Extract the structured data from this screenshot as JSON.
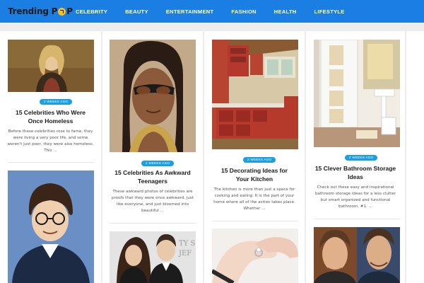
{
  "site": {
    "logo_text": "Trending P",
    "logo_suffix": "P"
  },
  "nav": [
    {
      "label": "CELEBRITY"
    },
    {
      "label": "BEAUTY"
    },
    {
      "label": "ENTERTAINMENT"
    },
    {
      "label": "FASHION"
    },
    {
      "label": "HEALTH"
    },
    {
      "label": "LIFESTYLE"
    }
  ],
  "articles": [
    {
      "badge": "2 WEEKS AGO",
      "title_line1": "15 Celebrities Who Were",
      "title_line2": "Once Homeless",
      "excerpt_line1": "Before these celebrities rose to fame, they",
      "excerpt_line2": "were living a very poor life, and some",
      "excerpt_line3": "weren't just poor, they were also homeless.",
      "excerpt_line4": "This ..."
    },
    {
      "badge": "2 WEEKS AGO",
      "title_line1": "15 Celebrities As Awkward",
      "title_line2": "Teenagers",
      "excerpt_line1": "These awkward photos of celebrities are",
      "excerpt_line2": "proofs that they were once awkward, just",
      "excerpt_line3": "like everyone, and just bloomed into",
      "excerpt_line4": "beautiful ..."
    },
    {
      "badge": "2 WEEKS AGO",
      "title_line1": "15 Decorating Ideas for",
      "title_line2": "Your Kitchen",
      "excerpt_line1": "The kitchen is more than just a space for",
      "excerpt_line2": "cooking and eating. It is the part of your",
      "excerpt_line3": "home where all of the action takes place.",
      "excerpt_line4": "Whether ..."
    },
    {
      "badge": "2 WEEKS AGO",
      "title_line1": "15 Clever Bathroom Storage",
      "title_line2": "Ideas",
      "excerpt_line1": "Check out these easy and inspirational",
      "excerpt_line2": "bathroom storage ideas for a less clutter",
      "excerpt_line3": "but smart organized and functional",
      "excerpt_line4": "bathroom. #1. ..."
    }
  ],
  "colors": {
    "header": "#1a7ee2",
    "badge": "#1a9fe0",
    "logo_accent": "#f6c21a"
  }
}
